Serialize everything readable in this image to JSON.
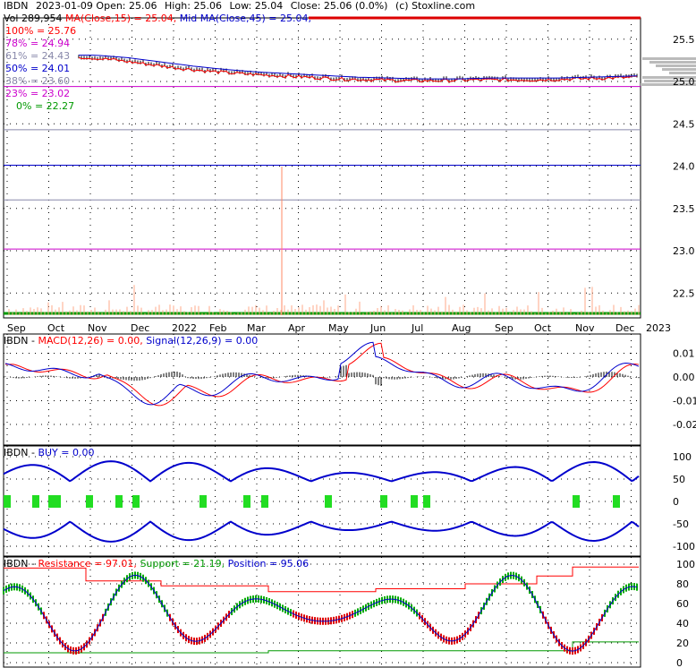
{
  "header": {
    "line1_parts": [
      "IBDN",
      "2023-01-09 Open: 25.06",
      "High: 25.06",
      "Low: 25.04",
      "Close: 25.06 (0.0%)",
      "(c) Stoxline.com"
    ],
    "vol_text": "Vol 289,954",
    "ma15_text": "MA(Close,15) = 25.04,",
    "ma45_text": "Mid MA(Close,45) = 25.04,"
  },
  "fib_levels": [
    {
      "label": "100% = 25.76",
      "color": "#ff0000"
    },
    {
      "label": "78% = 24.94",
      "color": "#cc00cc"
    },
    {
      "label": "61% = 24.43",
      "color": "#8888aa"
    },
    {
      "label": "50% = 24.01",
      "color": "#0000cc"
    },
    {
      "label": "38% = 23.60",
      "color": "#8888aa"
    },
    {
      "label": "23% = 23.02",
      "color": "#cc00cc"
    },
    {
      "label": "0% = 22.27",
      "color": "#009900"
    }
  ],
  "colors": {
    "red": "#ff0000",
    "blue": "#0000cc",
    "green": "#00cc00",
    "magenta": "#cc00cc",
    "gray": "#666666",
    "black": "#000000"
  },
  "chart_data": [
    {
      "type": "line",
      "name": "price",
      "y_ticks": [
        "25.5",
        "25.0",
        "24.5",
        "24.0",
        "23.5",
        "23.0",
        "22.5"
      ],
      "y_tick_values": [
        25.5,
        25.0,
        24.5,
        24.0,
        23.5,
        23.0,
        22.5
      ],
      "ylim": [
        22.27,
        25.76
      ],
      "fib_values": [
        25.76,
        24.94,
        24.43,
        24.01,
        23.6,
        23.02,
        22.27
      ],
      "x_ticks": [
        "Sep",
        "Oct",
        "Nov",
        "Dec",
        "2022",
        "Feb",
        "Mar",
        "Apr",
        "May",
        "Jun",
        "Jul",
        "Aug",
        "Sep",
        "Oct",
        "Nov",
        "Dec",
        "2023"
      ],
      "close_path": [
        25.3,
        25.27,
        25.22,
        25.17,
        25.13,
        25.1,
        25.08,
        25.06,
        25.04,
        25.03,
        25.02,
        25.02,
        25.03,
        25.03,
        25.03,
        25.04,
        25.05,
        25.06
      ]
    },
    {
      "type": "line",
      "name": "macd",
      "title": "IBDN - MACD(12,26) = 0.00, Signal(12,26,9) = 0.00",
      "y_ticks": [
        "0.01",
        "0.00",
        "-0.01",
        "-0.02"
      ],
      "y_tick_values": [
        0.01,
        0.0,
        -0.01,
        -0.02
      ],
      "ylim": [
        -0.027,
        0.015
      ]
    },
    {
      "type": "line",
      "name": "buy",
      "title": "IBDN - BUY = 0.00",
      "y_ticks": [
        "100",
        "50",
        "0",
        "-50",
        "-100"
      ],
      "y_tick_values": [
        100,
        50,
        0,
        -50,
        -100
      ],
      "ylim": [
        -110,
        110
      ]
    },
    {
      "type": "line",
      "name": "resistance",
      "title": "IBDN - Resistance = 97.01, Support = 21.19, Position = 95.06",
      "y_ticks": [
        "100",
        "80",
        "60",
        "40",
        "20",
        "0"
      ],
      "y_tick_values": [
        100,
        80,
        60,
        40,
        20,
        0
      ],
      "ylim": [
        -5,
        105
      ]
    }
  ],
  "panel_titles": {
    "macd_prefix": "IBDN - ",
    "macd_label": "MACD(12,26) = 0.00,",
    "macd_signal": "Signal(12,26,9) = 0.00",
    "buy_prefix": "IBDN - ",
    "buy_label": "BUY = 0.00",
    "res_prefix": "IBDN - ",
    "res_label": "Resistance = 97.01,",
    "res_support": "Support = 21.19,",
    "res_position": "Position = 95.06"
  }
}
